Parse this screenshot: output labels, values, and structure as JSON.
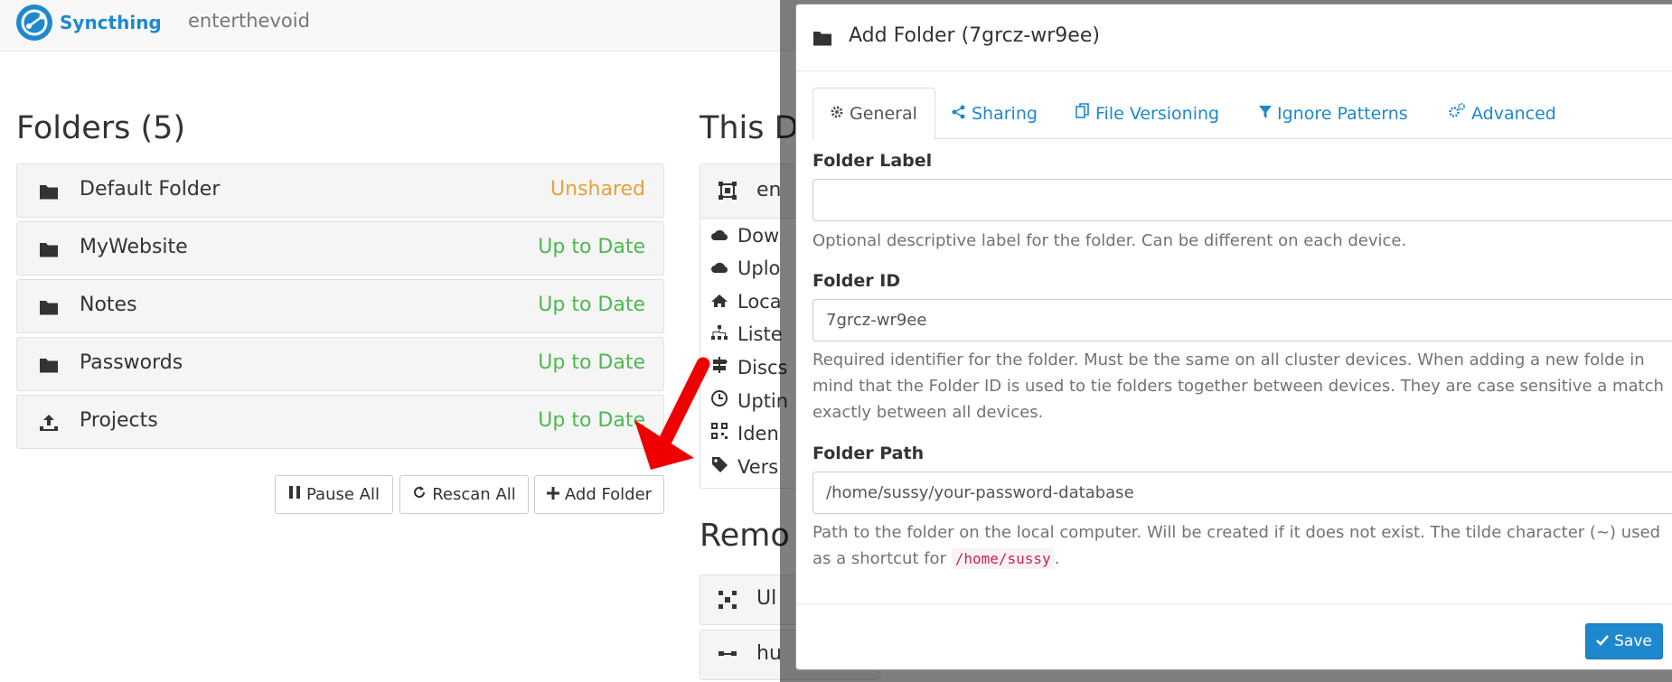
{
  "navbar": {
    "brand": "Syncthing",
    "device_name": "enterthevoid"
  },
  "folders": {
    "title": "Folders (5)",
    "items": [
      {
        "icon": "folder-icon",
        "name": "Default Folder",
        "status": "Unshared",
        "status_color": "#e6a13a"
      },
      {
        "icon": "folder-icon",
        "name": "MyWebsite",
        "status": "Up to Date",
        "status_color": "#4db852"
      },
      {
        "icon": "folder-icon",
        "name": "Notes",
        "status": "Up to Date",
        "status_color": "#4db852"
      },
      {
        "icon": "folder-icon",
        "name": "Passwords",
        "status": "Up to Date",
        "status_color": "#4db852"
      },
      {
        "icon": "upload-icon",
        "name": "Projects",
        "status": "Up to Date",
        "status_color": "#4db852"
      }
    ],
    "buttons": {
      "pause_all": "Pause All",
      "rescan_all": "Rescan All",
      "add_folder": "Add Folder"
    }
  },
  "this_device": {
    "title": "This D",
    "name": "en",
    "items": [
      "Dow",
      "Uplo",
      "Loca",
      "Liste",
      "Discs",
      "Uptin",
      "Iden",
      "Vers"
    ]
  },
  "remote": {
    "title": "Remo",
    "items": [
      "Ul",
      "hu"
    ]
  },
  "modal": {
    "title": "Add Folder (7grcz-wr9ee)",
    "tabs": [
      {
        "label": "General",
        "icon": "gear-icon"
      },
      {
        "label": "Sharing",
        "icon": "share-icon"
      },
      {
        "label": "File Versioning",
        "icon": "copy-icon"
      },
      {
        "label": "Ignore Patterns",
        "icon": "filter-icon"
      },
      {
        "label": "Advanced",
        "icon": "gears-icon"
      }
    ],
    "folder_label": {
      "label": "Folder Label",
      "value": "",
      "help": "Optional descriptive label for the folder. Can be different on each device."
    },
    "folder_id": {
      "label": "Folder ID",
      "value": "7grcz-wr9ee",
      "help": "Required identifier for the folder. Must be the same on all cluster devices. When adding a new folde in mind that the Folder ID is used to tie folders together between devices. They are case sensitive a match exactly between all devices."
    },
    "folder_path": {
      "label": "Folder Path",
      "value": "/home/sussy/your-password-database",
      "help_before": "Path to the folder on the local computer. Will be created if it does not exist. The tilde character (~) used as a shortcut for",
      "help_code": "/home/sussy",
      "help_after": "."
    },
    "save_label": "Save"
  },
  "colors": {
    "brand": "#1e88cf",
    "unshared": "#e6a13a",
    "up_to_date": "#4db852",
    "annotation_arrow": "#ee0000"
  }
}
